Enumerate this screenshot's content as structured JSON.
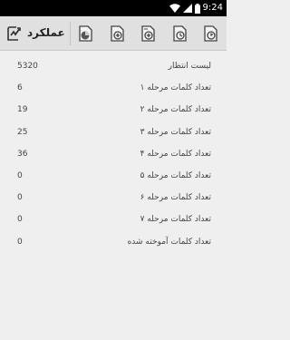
{
  "status_bar": {
    "time": "9:24"
  },
  "action_bar": {
    "title": "عملکرد",
    "icons": [
      "performance-icon",
      "chart-icon",
      "add-page-icon",
      "page-add-icon",
      "page-clock-icon",
      "page-timer-icon"
    ]
  },
  "stats": [
    {
      "label": "لیست انتظار",
      "value": "5320"
    },
    {
      "label": "تعداد کلمات مرحله ۱",
      "value": "6"
    },
    {
      "label": "تعداد کلمات مرحله ۲",
      "value": "19"
    },
    {
      "label": "تعداد کلمات مرحله ۳",
      "value": "25"
    },
    {
      "label": "تعداد کلمات مرحله ۴",
      "value": "36"
    },
    {
      "label": "تعداد کلمات مرحله ۵",
      "value": "0"
    },
    {
      "label": "تعداد کلمات مرحله ۶",
      "value": "0"
    },
    {
      "label": "تعداد کلمات مرحله ۷",
      "value": "0"
    },
    {
      "label": "تعداد کلمات آموخته شده",
      "value": "0"
    }
  ]
}
